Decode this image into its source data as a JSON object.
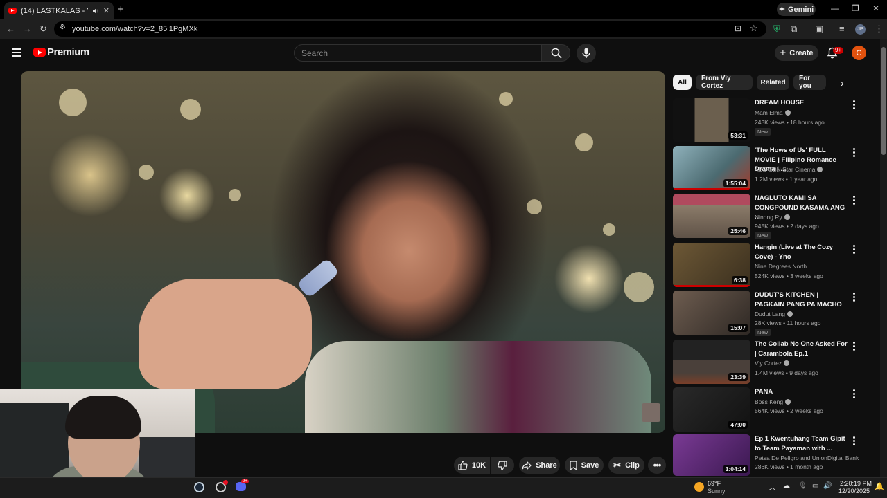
{
  "browser": {
    "tab_title": "(14) LASTKALAS - YouTube",
    "new_tab": "+",
    "gemini_label": "Gemini",
    "url": "youtube.com/watch?v=2_85i1PgMXk",
    "profile_initials": "JP"
  },
  "header": {
    "logo_text": "Premium",
    "search_placeholder": "Search",
    "create_label": "Create",
    "notifications_badge": "9+",
    "avatar_letter": "C"
  },
  "actions": {
    "like_count": "10K",
    "share_label": "Share",
    "save_label": "Save",
    "clip_label": "Clip"
  },
  "chips": [
    "All",
    "From Viy Cortez",
    "Related",
    "For you"
  ],
  "recommendations": [
    {
      "title": "DREAM HOUSE",
      "channel": "Mam Elma",
      "verified": true,
      "meta": "243K views • 18 hours ago",
      "duration": "53:31",
      "is_new": true,
      "new_label": "New",
      "thumb_color": "#3a3a38"
    },
    {
      "title": "'The Hows of Us' FULL MOVIE | Filipino Romance Drama | ...",
      "channel": "ABS-CBN Star Cinema",
      "verified": true,
      "meta": "1.2M views • 1 year ago",
      "duration": "1:55:04",
      "is_new": false,
      "thumb_color": "#5a7d86"
    },
    {
      "title": "NAGLUTO KAMI SA CONGPOUND KASAMA ANG ...",
      "channel": "Ninong Ry",
      "verified": true,
      "meta": "945K views • 2 days ago",
      "duration": "25:46",
      "is_new": true,
      "new_label": "New",
      "thumb_color": "#7e6b5a"
    },
    {
      "title": "Hangin (Live at The Cozy Cove) - Yno",
      "channel": "Nine Degrees North",
      "verified": false,
      "meta": "524K views • 3 weeks ago",
      "duration": "6:38",
      "is_new": false,
      "thumb_color": "#5b4a2e"
    },
    {
      "title": "DUDUT'S KITCHEN | PAGKAIN PANG PA MACHO",
      "channel": "Dudut Lang",
      "verified": true,
      "meta": "28K views • 11 hours ago",
      "duration": "15:07",
      "is_new": true,
      "new_label": "New",
      "thumb_color": "#4d4440"
    },
    {
      "title": "The Collab No One Asked For | Carambola Ep.1",
      "channel": "Viy Cortez",
      "verified": true,
      "meta": "1.4M views • 9 days ago",
      "duration": "23:39",
      "is_new": false,
      "thumb_color": "#2e2a2c"
    },
    {
      "title": "PANA",
      "channel": "Boss Keng",
      "verified": true,
      "meta": "564K views • 2 weeks ago",
      "duration": "47:00",
      "is_new": false,
      "thumb_color": "#1e1e1e"
    },
    {
      "title": "Ep 1 Kwentuhang Team Gipit to Team Payaman with ...",
      "channel": "Petsa De Peligro and UnionDigital Bank",
      "verified": false,
      "meta": "286K views • 1 month ago",
      "duration": "1:04:14",
      "is_new": false,
      "thumb_color": "#5a2c6e"
    }
  ],
  "taskbar": {
    "app_badge": "9+",
    "weather_temp": "69°F",
    "weather_cond": "Sunny",
    "time": "2:20:19 PM",
    "date": "12/20/2025"
  },
  "colors": {
    "background": "#0f0f0f",
    "accent_red": "#ff0000",
    "avatar": "#e2520e"
  }
}
